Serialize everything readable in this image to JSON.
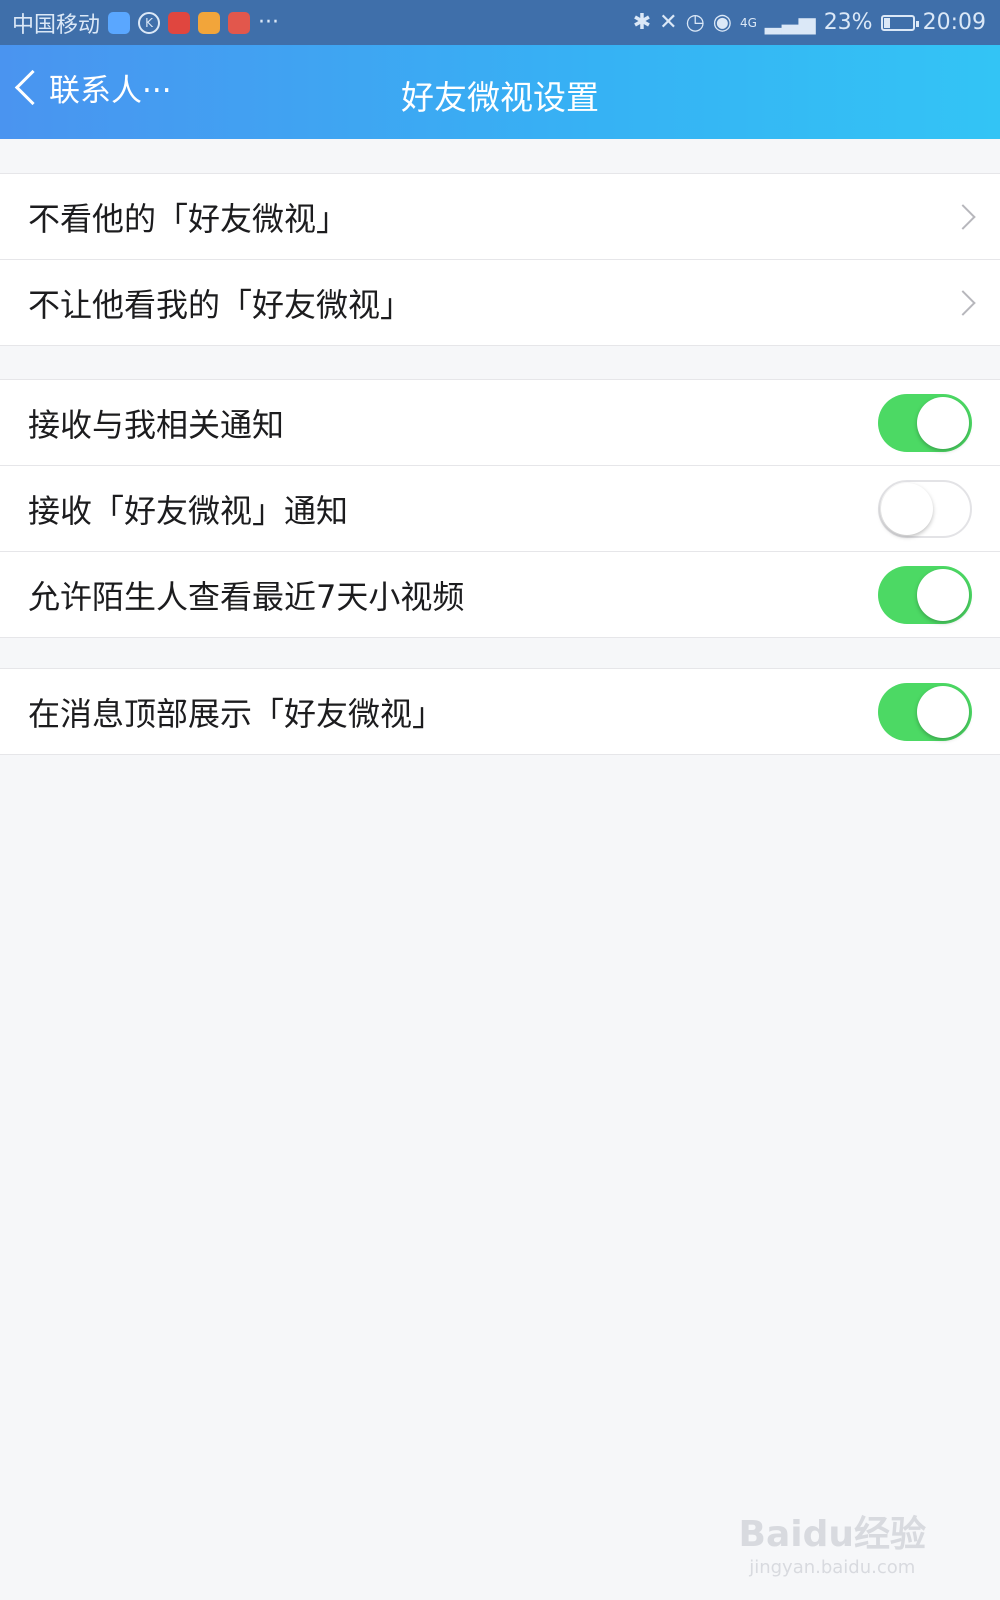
{
  "status_bar": {
    "carrier": "中国移动",
    "dots": "···",
    "network": "4G",
    "battery": "23%",
    "battery_level": 0.23,
    "time": "20:09"
  },
  "nav": {
    "back_label": "联系人···",
    "title": "好友微视设置"
  },
  "groups": [
    {
      "rows": [
        {
          "label": "不看他的「好友微视」",
          "control": "chevron"
        },
        {
          "label": "不让他看我的「好友微视」",
          "control": "chevron"
        }
      ]
    },
    {
      "rows": [
        {
          "label": "接收与我相关通知",
          "control": "toggle",
          "on": true
        },
        {
          "label": "接收「好友微视」通知",
          "control": "toggle",
          "on": false
        },
        {
          "label": "允许陌生人查看最近7天小视频",
          "control": "toggle",
          "on": true
        }
      ]
    },
    {
      "rows": [
        {
          "label": "在消息顶部展示「好友微视」",
          "control": "toggle",
          "on": true
        }
      ]
    }
  ],
  "watermark": {
    "main": "Baidu经验",
    "sub": "jingyan.baidu.com"
  },
  "colors": {
    "toggle_on": "#4cd964",
    "nav_gradient_start": "#4a94f0",
    "nav_gradient_end": "#33c4f5",
    "status_bar": "#3f6faa"
  }
}
